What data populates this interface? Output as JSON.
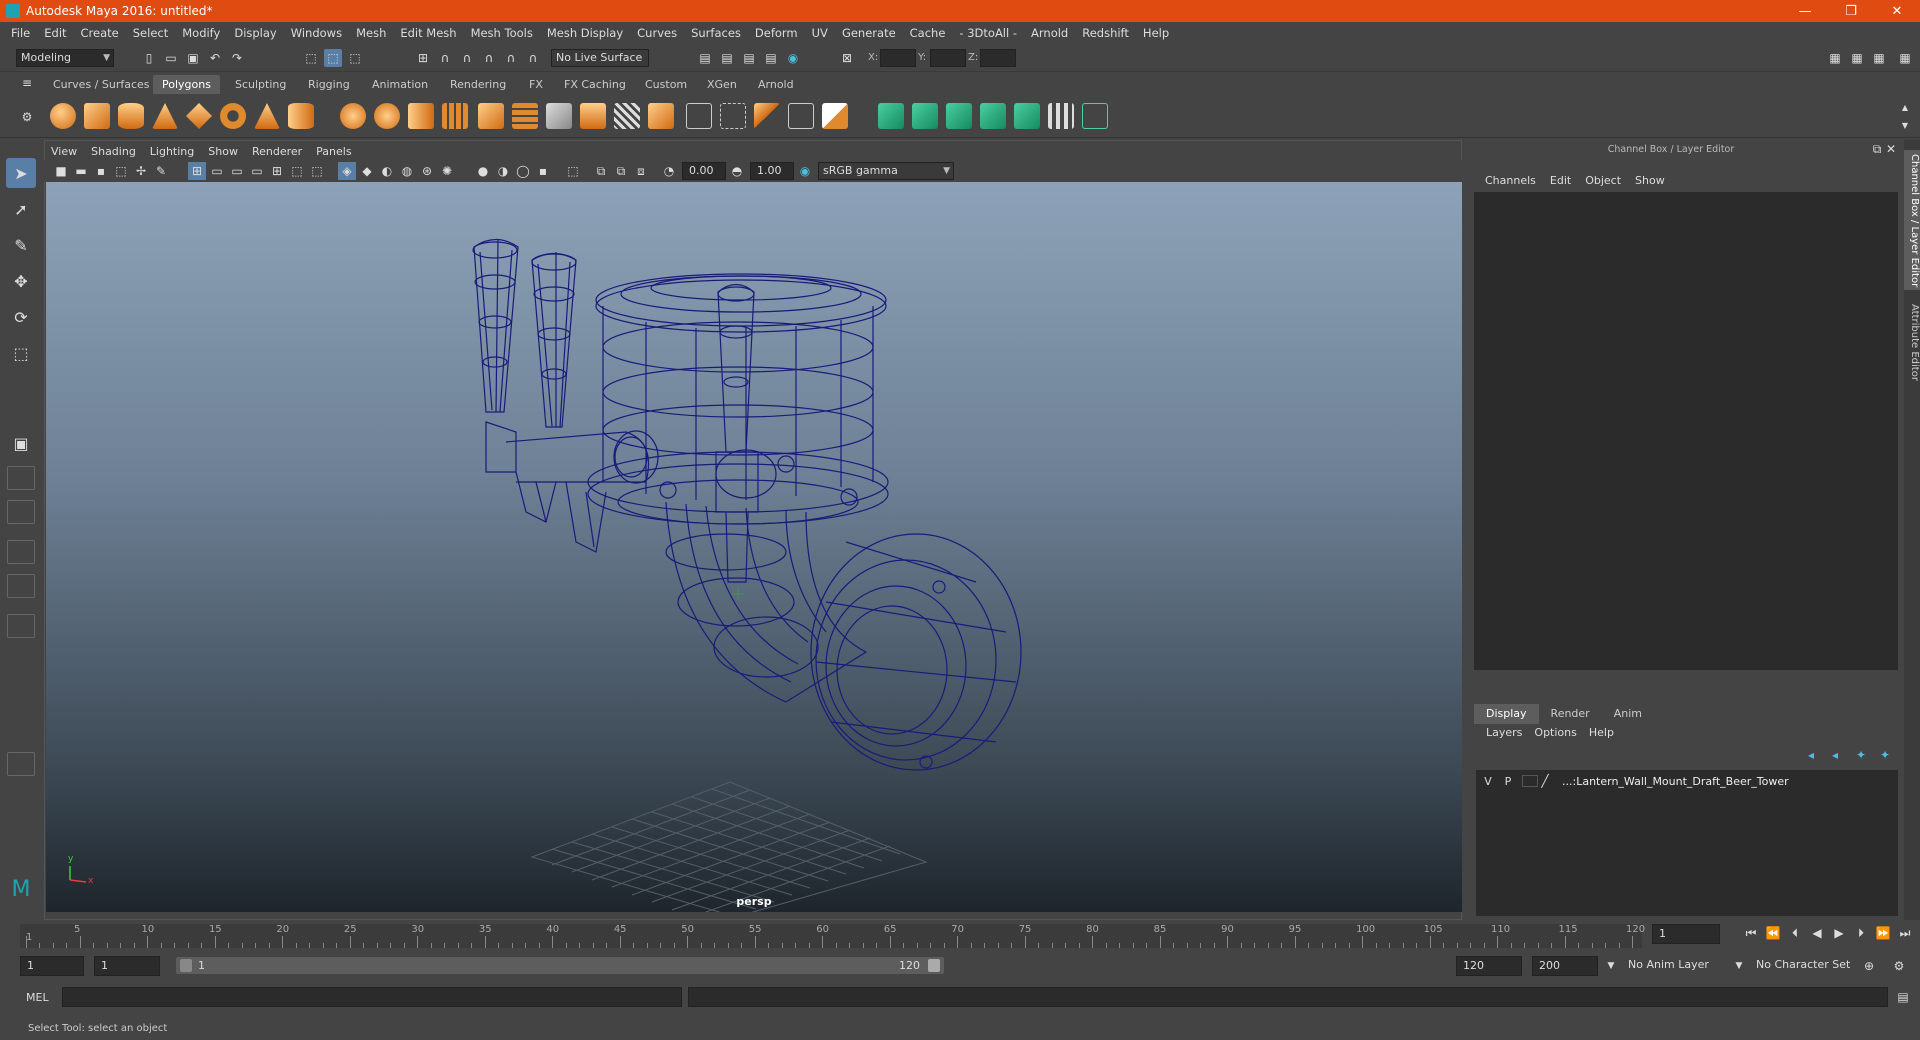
{
  "window": {
    "title": "Autodesk Maya 2016: untitled*",
    "controls": [
      "—",
      "❐",
      "✕"
    ]
  },
  "menubar": [
    "File",
    "Edit",
    "Create",
    "Select",
    "Modify",
    "Display",
    "Windows",
    "Mesh",
    "Edit Mesh",
    "Mesh Tools",
    "Mesh Display",
    "Curves",
    "Surfaces",
    "Deform",
    "UV",
    "Generate",
    "Cache",
    "- 3DtoAll -",
    "Arnold",
    "Redshift",
    "Help"
  ],
  "statusline": {
    "mode": "Modeling",
    "live_surface": "No Live Surface",
    "x_label": "X:",
    "y_label": "Y:",
    "z_label": "Z:"
  },
  "shelf_tabs": [
    "Curves / Surfaces",
    "Polygons",
    "Sculpting",
    "Rigging",
    "Animation",
    "Rendering",
    "FX",
    "FX Caching",
    "Custom",
    "XGen",
    "Arnold"
  ],
  "shelf_active": "Polygons",
  "panel_menu": [
    "View",
    "Shading",
    "Lighting",
    "Show",
    "Renderer",
    "Panels"
  ],
  "panel_tools": {
    "exposure": "0.00",
    "gamma": "1.00",
    "color_space": "sRGB gamma"
  },
  "viewport": {
    "camera": "persp",
    "axis_y": "y",
    "axis_x": "x",
    "wire_color": "#1a1a7a"
  },
  "channel_box": {
    "title": "Channel Box / Layer Editor",
    "menu": [
      "Channels",
      "Edit",
      "Object",
      "Show"
    ]
  },
  "layer_editor": {
    "tabs": [
      "Display",
      "Render",
      "Anim"
    ],
    "active_tab": "Display",
    "menu": [
      "Layers",
      "Options",
      "Help"
    ],
    "layer": {
      "v": "V",
      "p": "P",
      "name": "...:Lantern_Wall_Mount_Draft_Beer_Tower"
    }
  },
  "side_tabs": [
    "Channel Box / Layer Editor",
    "Attribute Editor"
  ],
  "timeslider": {
    "ticks": [
      "5",
      "10",
      "15",
      "20",
      "25",
      "30",
      "35",
      "40",
      "45",
      "50",
      "55",
      "60",
      "65",
      "70",
      "75",
      "80",
      "85",
      "90",
      "95",
      "100",
      "105",
      "110",
      "115",
      "120"
    ],
    "start_tick": "1",
    "current_frame": "1"
  },
  "rangeslider": {
    "start": "1",
    "current": "1",
    "range_start": "1",
    "range_end": "120",
    "end": "120",
    "max_end": "200",
    "anim_layer": "No Anim Layer",
    "char_set": "No Character Set"
  },
  "cmdline": {
    "label": "MEL"
  },
  "helpline": {
    "text": "Select Tool: select an object"
  }
}
